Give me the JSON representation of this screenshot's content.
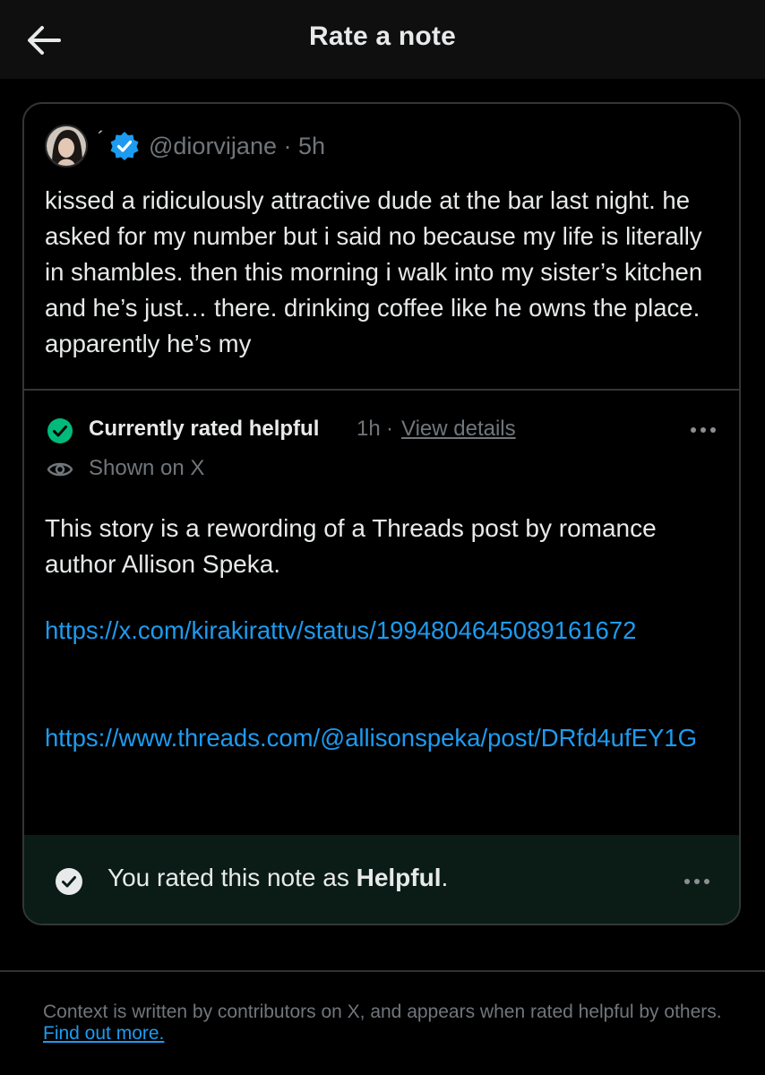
{
  "header": {
    "title": "Rate a note",
    "back_icon": "arrow-left-icon"
  },
  "tweet": {
    "tick_mark": "´",
    "handle": "@diorvijane",
    "time_separator": "·",
    "time": "5h",
    "text": "kissed a ridiculously attractive dude at the bar last night. he asked for my number but i said no because my life is literally in shambles. then this morning i walk into my sister’s kitchen and he’s just… there. drinking coffee like he owns the place. apparently he’s my",
    "verified_icon": "verified-badge-icon",
    "verified_color": "#1d9bf0"
  },
  "note": {
    "status_label": "Currently rated helpful",
    "status_time": "1h",
    "status_separator": "·",
    "view_details_label": "View details",
    "shown_label": "Shown on X",
    "text": "This story is a rewording of a Threads post by romance author Allison Speka.",
    "links": [
      "https://x.com/kirakirattv/status/1994804645089161672",
      "https://www.threads.com/@allisonspeka/post/DRfd4ufEY1G"
    ],
    "status_color": "#00ba7c",
    "link_color": "#1d9bf0"
  },
  "rating": {
    "prefix": "You rated this note as ",
    "value": "Helpful",
    "suffix": "."
  },
  "footer": {
    "text": "Context is written by contributors on X, and appears when rated helpful by others.",
    "link_label": "Find out more."
  }
}
